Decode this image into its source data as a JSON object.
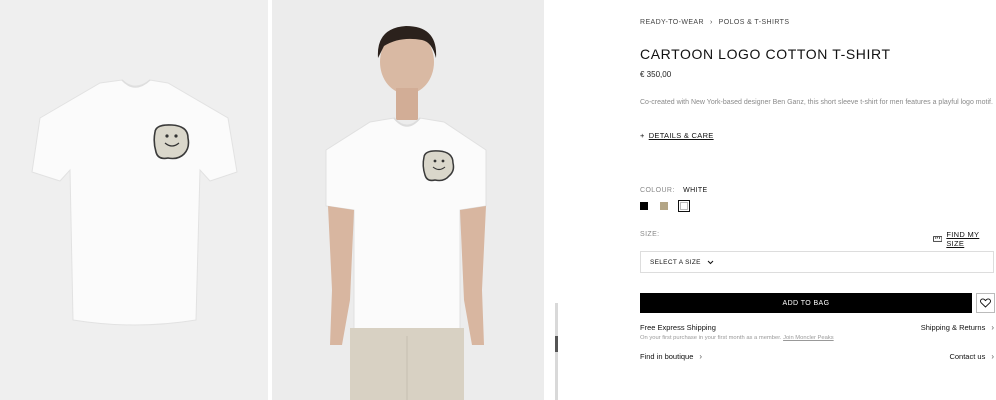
{
  "breadcrumb": {
    "items": [
      "READY-TO-WEAR",
      "POLOS & T-SHIRTS"
    ],
    "separator": "›"
  },
  "product": {
    "title": "CARTOON LOGO COTTON T-SHIRT",
    "price": "€ 350,00",
    "description": "Co-created with New York-based designer Ben Ganz, this short sleeve t-shirt for men features a playful logo motif.",
    "details_label": "DETAILS & CARE",
    "details_prefix": "+"
  },
  "colour": {
    "label": "COLOUR:",
    "value": "WHITE",
    "swatches": [
      {
        "name": "black",
        "color": "#000000"
      },
      {
        "name": "beige",
        "color": "#b3a586"
      },
      {
        "name": "white",
        "color": "#ffffff",
        "selected": true
      }
    ]
  },
  "size": {
    "label": "SIZE:",
    "find_label": "FIND MY SIZE",
    "select_placeholder": "SELECT A SIZE"
  },
  "actions": {
    "add_to_bag": "ADD TO BAG"
  },
  "shipping": {
    "title": "Free Express Shipping",
    "note_prefix": "On your first purchase in your first month as a member.",
    "note_link": "Join Moncler Peaks",
    "returns_label": "Shipping & Returns"
  },
  "boutique_label": "Find in boutique",
  "contact_label": "Contact us",
  "colors": {
    "accent": "#000000",
    "muted": "#888888"
  }
}
